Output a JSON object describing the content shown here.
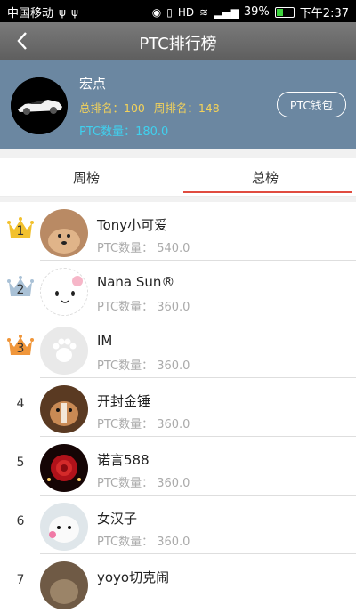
{
  "status_bar": {
    "carrier": "中国移动",
    "battery": "39%",
    "battery_level": 0.39,
    "time": "下午2:37"
  },
  "header": {
    "title": "PTC排行榜"
  },
  "profile": {
    "name": "宏点",
    "total_rank_label": "总排名：100",
    "week_rank_label": "周排名：148",
    "ptc_label": "PTC数量：180.0",
    "wallet_button": "PTC钱包"
  },
  "tabs": [
    {
      "label": "周榜",
      "active": false
    },
    {
      "label": "总榜",
      "active": true
    }
  ],
  "ranking": [
    {
      "rank": "1",
      "name": "Tony小可爱",
      "ptc": "PTC数量： 540.0",
      "crown": "gold"
    },
    {
      "rank": "2",
      "name": "Nana Sun®",
      "ptc": "PTC数量： 360.0",
      "crown": "silver"
    },
    {
      "rank": "3",
      "name": "IM",
      "ptc": "PTC数量： 360.0",
      "crown": "bronze"
    },
    {
      "rank": "4",
      "name": "开封金锤",
      "ptc": "PTC数量： 360.0"
    },
    {
      "rank": "5",
      "name": "诺言588",
      "ptc": "PTC数量： 360.0"
    },
    {
      "rank": "6",
      "name": "女汉子",
      "ptc": "PTC数量： 360.0"
    },
    {
      "rank": "7",
      "name": "yoyo切克闹",
      "ptc": ""
    }
  ],
  "colors": {
    "profile_bg": "#6b87a1",
    "rank_text": "#f3d25a",
    "ptc_text": "#40d0ee",
    "tab_underline": "#e04b3f",
    "crown_gold": "#f2c12e",
    "crown_silver": "#a9c1d6",
    "crown_bronze": "#f0963a"
  }
}
